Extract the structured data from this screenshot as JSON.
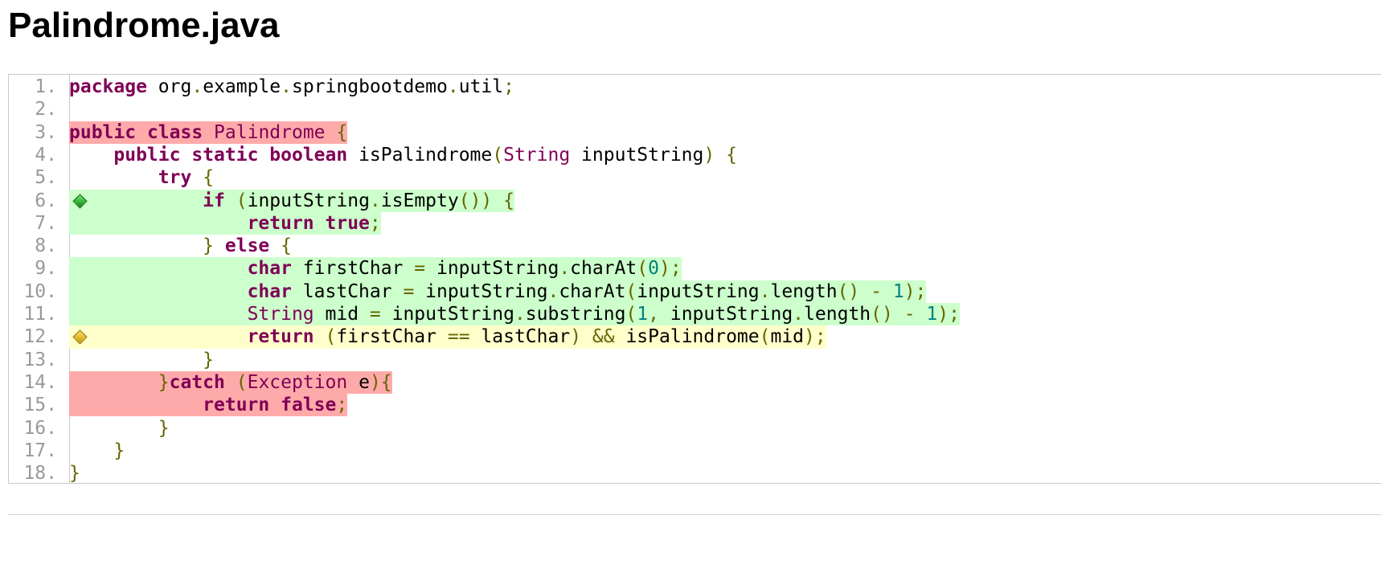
{
  "page": {
    "title": "Palindrome.java"
  },
  "colors": {
    "not_covered": "#ffaaaa",
    "covered": "#ccffcc",
    "partly_covered": "#ffffcc",
    "keyword": "#7f0055",
    "punctuation": "#666600",
    "number": "#008080"
  },
  "code": {
    "lines": [
      {
        "num": "1.",
        "tokens": [
          [
            "kw",
            "package"
          ],
          [
            "t",
            " org"
          ],
          [
            "pu",
            "."
          ],
          [
            "t",
            "example"
          ],
          [
            "pu",
            "."
          ],
          [
            "t",
            "springbootdemo"
          ],
          [
            "pu",
            "."
          ],
          [
            "t",
            "util"
          ],
          [
            "pu",
            ";"
          ]
        ]
      },
      {
        "num": "2.",
        "tokens": []
      },
      {
        "num": "3.",
        "coverage": "not_covered",
        "tokens": [
          [
            "kw",
            "public"
          ],
          [
            "t",
            " "
          ],
          [
            "kw",
            "class"
          ],
          [
            "ty",
            " Palindrome"
          ],
          [
            "t",
            " "
          ],
          [
            "pu",
            "{"
          ]
        ]
      },
      {
        "num": "4.",
        "tokens": [
          [
            "t",
            "    "
          ],
          [
            "kw",
            "public"
          ],
          [
            "t",
            " "
          ],
          [
            "kw",
            "static"
          ],
          [
            "t",
            " "
          ],
          [
            "kw",
            "boolean"
          ],
          [
            "t",
            " isPalindrome"
          ],
          [
            "pu",
            "("
          ],
          [
            "ty",
            "String"
          ],
          [
            "t",
            " inputString"
          ],
          [
            "pu",
            ")"
          ],
          [
            "t",
            " "
          ],
          [
            "pu",
            "{"
          ]
        ]
      },
      {
        "num": "5.",
        "tokens": [
          [
            "t",
            "        "
          ],
          [
            "kw",
            "try"
          ],
          [
            "t",
            " "
          ],
          [
            "pu",
            "{"
          ]
        ]
      },
      {
        "num": "6.",
        "coverage": "covered",
        "branch": "green-diamond-icon",
        "tokens": [
          [
            "t",
            "            "
          ],
          [
            "kw",
            "if"
          ],
          [
            "t",
            " "
          ],
          [
            "pu",
            "("
          ],
          [
            "t",
            "inputString"
          ],
          [
            "pu",
            "."
          ],
          [
            "t",
            "isEmpty"
          ],
          [
            "pu",
            "())"
          ],
          [
            "t",
            " "
          ],
          [
            "pu",
            "{"
          ]
        ]
      },
      {
        "num": "7.",
        "coverage": "covered",
        "tokens": [
          [
            "t",
            "                "
          ],
          [
            "kw",
            "return"
          ],
          [
            "t",
            " "
          ],
          [
            "kw",
            "true"
          ],
          [
            "pu",
            ";"
          ]
        ]
      },
      {
        "num": "8.",
        "tokens": [
          [
            "t",
            "            "
          ],
          [
            "pu",
            "}"
          ],
          [
            "t",
            " "
          ],
          [
            "kw",
            "else"
          ],
          [
            "t",
            " "
          ],
          [
            "pu",
            "{"
          ]
        ]
      },
      {
        "num": "9.",
        "coverage": "covered",
        "tokens": [
          [
            "t",
            "                "
          ],
          [
            "kw",
            "char"
          ],
          [
            "t",
            " firstChar "
          ],
          [
            "pu",
            "="
          ],
          [
            "t",
            " inputString"
          ],
          [
            "pu",
            "."
          ],
          [
            "t",
            "charAt"
          ],
          [
            "pu",
            "("
          ],
          [
            "nm",
            "0"
          ],
          [
            "pu",
            ");"
          ]
        ]
      },
      {
        "num": "10.",
        "coverage": "covered",
        "tokens": [
          [
            "t",
            "                "
          ],
          [
            "kw",
            "char"
          ],
          [
            "t",
            " lastChar "
          ],
          [
            "pu",
            "="
          ],
          [
            "t",
            " inputString"
          ],
          [
            "pu",
            "."
          ],
          [
            "t",
            "charAt"
          ],
          [
            "pu",
            "("
          ],
          [
            "t",
            "inputString"
          ],
          [
            "pu",
            "."
          ],
          [
            "t",
            "length"
          ],
          [
            "pu",
            "()"
          ],
          [
            "t",
            " "
          ],
          [
            "pu",
            "-"
          ],
          [
            "t",
            " "
          ],
          [
            "nm",
            "1"
          ],
          [
            "pu",
            ");"
          ]
        ]
      },
      {
        "num": "11.",
        "coverage": "covered",
        "tokens": [
          [
            "t",
            "                "
          ],
          [
            "ty",
            "String"
          ],
          [
            "t",
            " mid "
          ],
          [
            "pu",
            "="
          ],
          [
            "t",
            " inputString"
          ],
          [
            "pu",
            "."
          ],
          [
            "t",
            "substring"
          ],
          [
            "pu",
            "("
          ],
          [
            "nm",
            "1"
          ],
          [
            "pu",
            ","
          ],
          [
            "t",
            " inputString"
          ],
          [
            "pu",
            "."
          ],
          [
            "t",
            "length"
          ],
          [
            "pu",
            "()"
          ],
          [
            "t",
            " "
          ],
          [
            "pu",
            "-"
          ],
          [
            "t",
            " "
          ],
          [
            "nm",
            "1"
          ],
          [
            "pu",
            ");"
          ]
        ]
      },
      {
        "num": "12.",
        "coverage": "partly_covered",
        "branch": "yellow-diamond-icon",
        "tokens": [
          [
            "t",
            "                "
          ],
          [
            "kw",
            "return"
          ],
          [
            "t",
            " "
          ],
          [
            "pu",
            "("
          ],
          [
            "t",
            "firstChar "
          ],
          [
            "pu",
            "=="
          ],
          [
            "t",
            " lastChar"
          ],
          [
            "pu",
            ")"
          ],
          [
            "t",
            " "
          ],
          [
            "pu",
            "&&"
          ],
          [
            "t",
            " isPalindrome"
          ],
          [
            "pu",
            "("
          ],
          [
            "t",
            "mid"
          ],
          [
            "pu",
            ");"
          ]
        ]
      },
      {
        "num": "13.",
        "tokens": [
          [
            "t",
            "            "
          ],
          [
            "pu",
            "}"
          ]
        ]
      },
      {
        "num": "14.",
        "coverage": "not_covered",
        "tokens": [
          [
            "t",
            "        "
          ],
          [
            "pu",
            "}"
          ],
          [
            "kw",
            "catch"
          ],
          [
            "t",
            " "
          ],
          [
            "pu",
            "("
          ],
          [
            "ty",
            "Exception"
          ],
          [
            "t",
            " e"
          ],
          [
            "pu",
            ")"
          ],
          [
            "pu",
            "{"
          ]
        ]
      },
      {
        "num": "15.",
        "coverage": "not_covered",
        "tokens": [
          [
            "t",
            "            "
          ],
          [
            "kw",
            "return"
          ],
          [
            "t",
            " "
          ],
          [
            "kw",
            "false"
          ],
          [
            "pu",
            ";"
          ]
        ]
      },
      {
        "num": "16.",
        "tokens": [
          [
            "t",
            "        "
          ],
          [
            "pu",
            "}"
          ]
        ]
      },
      {
        "num": "17.",
        "tokens": [
          [
            "t",
            "    "
          ],
          [
            "pu",
            "}"
          ]
        ]
      },
      {
        "num": "18.",
        "tokens": [
          [
            "pu",
            "}"
          ]
        ]
      }
    ]
  }
}
